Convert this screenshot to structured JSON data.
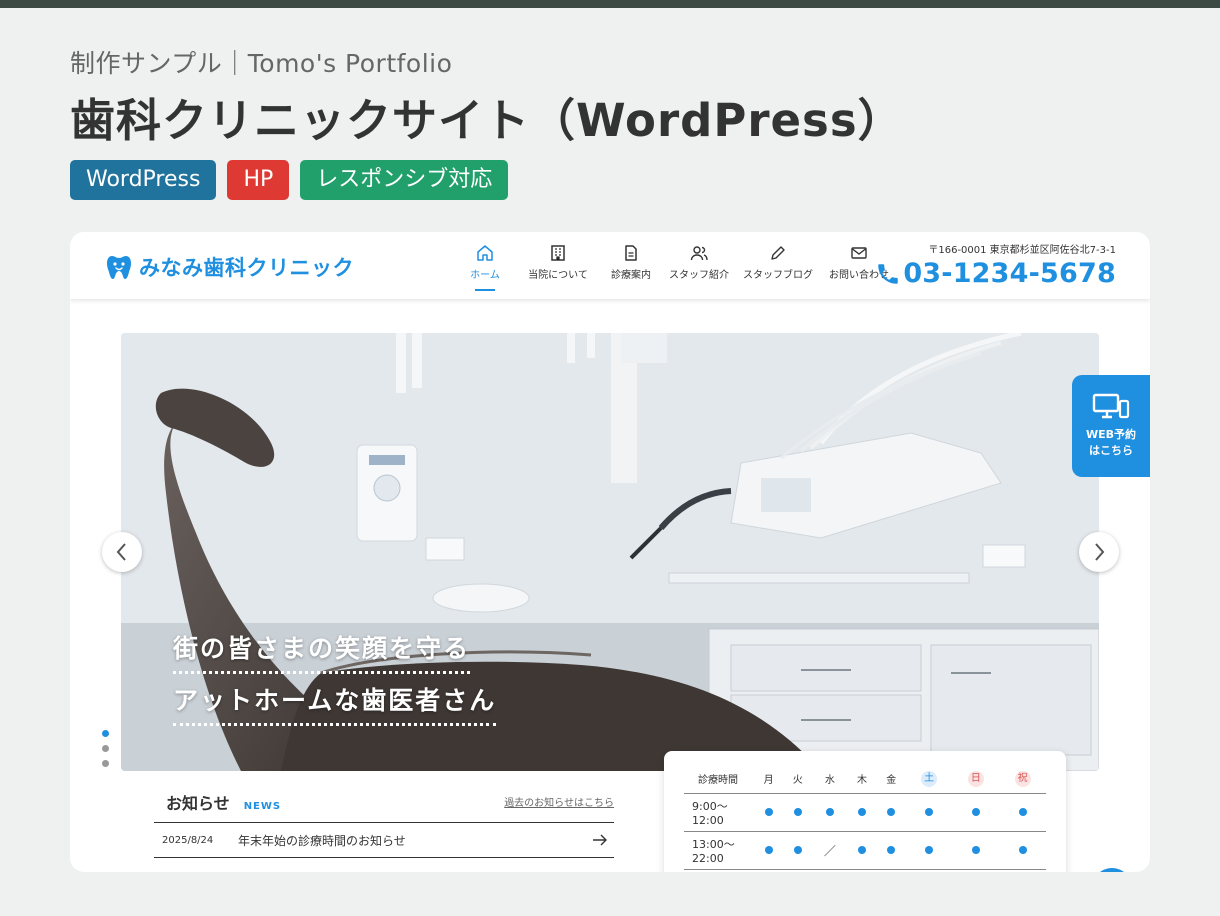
{
  "page": {
    "subtitle": "制作サンプル｜Tomo's Portfolio",
    "title": "歯科クリニックサイト（WordPress）",
    "tags": [
      {
        "label": "WordPress",
        "color": "#20739c"
      },
      {
        "label": "HP",
        "color": "#de3a33"
      },
      {
        "label": "レスポンシブ対応",
        "color": "#22a06b"
      }
    ]
  },
  "site": {
    "logo": {
      "text": "みなみ歯科クリニック",
      "icon": "tooth-icon"
    },
    "nav": [
      {
        "label": "ホーム",
        "icon": "home-icon",
        "active": true
      },
      {
        "label": "当院について",
        "icon": "building-icon",
        "active": false
      },
      {
        "label": "診療案内",
        "icon": "document-icon",
        "active": false
      },
      {
        "label": "スタッフ紹介",
        "icon": "users-icon",
        "active": false
      },
      {
        "label": "スタッフブログ",
        "icon": "pencil-icon",
        "active": false
      },
      {
        "label": "お問い合わせ",
        "icon": "mail-icon",
        "active": false
      }
    ],
    "address": "〒166-0001 東京都杉並区阿佐谷北7-3-1",
    "phone": "03-1234-5678",
    "accent_color": "#1f8fe0"
  },
  "hero": {
    "catch_line1": "街の皆さまの笑顔を守る",
    "catch_line2": "アットホームな歯医者さん",
    "slide_count": 3,
    "active_slide": 1
  },
  "web_reserve": {
    "line1": "WEB予約",
    "line2": "はこちら",
    "icon": "devices-icon"
  },
  "news": {
    "title": "お知らせ",
    "subtitle": "NEWS",
    "more_link": "過去のお知らせはこちら",
    "items": [
      {
        "date": "2025/8/24",
        "text": "年末年始の診療時間のお知らせ"
      }
    ]
  },
  "hours": {
    "header_label": "診療時間",
    "days": [
      "月",
      "火",
      "水",
      "木",
      "金",
      "土",
      "日",
      "祝"
    ],
    "rows": [
      {
        "time": "9:00〜12:00",
        "marks": [
          "●",
          "●",
          "●",
          "●",
          "●",
          "●",
          "●",
          "●"
        ]
      },
      {
        "time": "13:00〜22:00",
        "marks": [
          "●",
          "●",
          "／",
          "●",
          "●",
          "●",
          "●",
          "●"
        ]
      }
    ]
  }
}
